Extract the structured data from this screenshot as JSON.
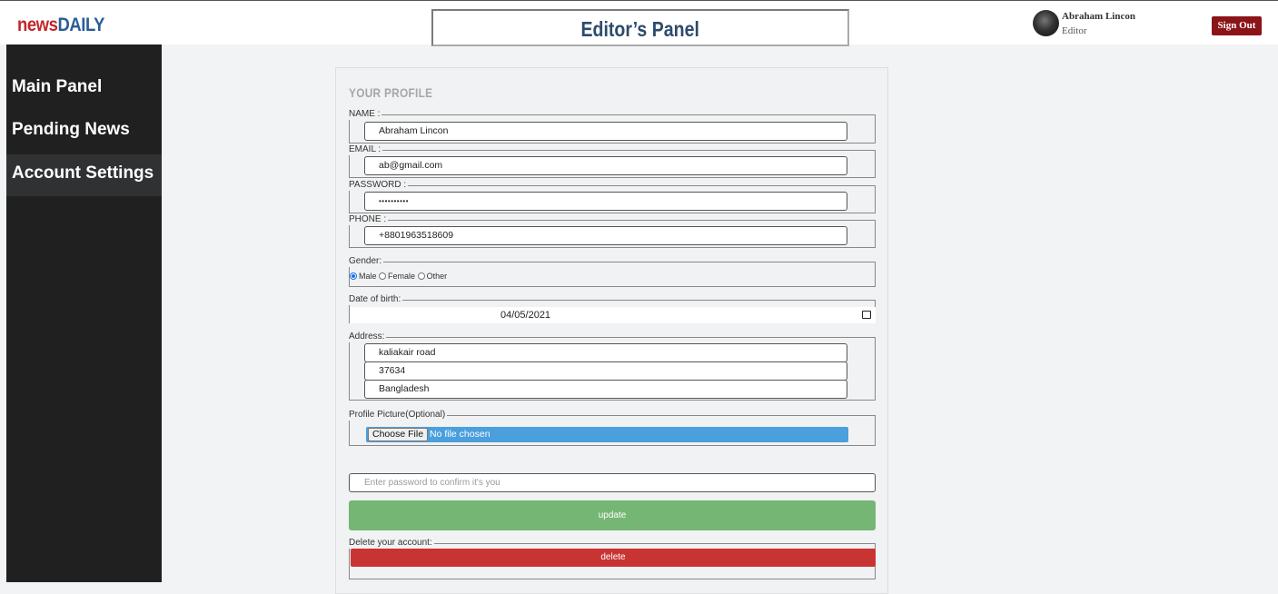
{
  "app": {
    "logo_part1": "news",
    "logo_part2": "DAILY",
    "panel_title": "Editor’s Panel"
  },
  "user": {
    "name": "Abraham Lincon",
    "role": "Editor",
    "sign_out_label": "Sign Out"
  },
  "sidebar": {
    "items": [
      {
        "label": "Main Panel"
      },
      {
        "label": "Pending News"
      },
      {
        "label": "Account Settings"
      }
    ]
  },
  "profile": {
    "title": "YOUR PROFILE",
    "name_label": "NAME :",
    "name_value": "Abraham Lincon",
    "email_label": "EMAIL :",
    "email_value": "ab@gmail.com",
    "password_label": "PASSWORD :",
    "password_value": "••••••••••",
    "phone_label": "PHONE :",
    "phone_value": "+8801963518609",
    "gender_label": "Gender:",
    "gender_options": [
      "Male",
      "Female",
      "Other"
    ],
    "gender_selected": "Male",
    "dob_label": "Date of birth:",
    "dob_value": "04/05/2021",
    "address_label": "Address:",
    "address_line1": "kaliakair road",
    "address_line2": "37634",
    "address_line3": "Bangladesh",
    "picture_label": "Profile Picture(Optional)",
    "choose_file_label": "Choose File",
    "no_file_label": "No file chosen",
    "confirm_placeholder": "Enter password to confirm it's you",
    "update_label": "update",
    "delete_label": "Delete your account:",
    "delete_button_label": "delete"
  },
  "colors": {
    "logo_red": "#c0282b",
    "logo_blue": "#2a5d96",
    "panel_title": "#2d4b6c",
    "sign_out_bg": "#8b1418",
    "sidebar_bg": "#202020",
    "update_green": "#75b674",
    "delete_red": "#c83432",
    "file_bar_blue": "#4a9fdc"
  }
}
